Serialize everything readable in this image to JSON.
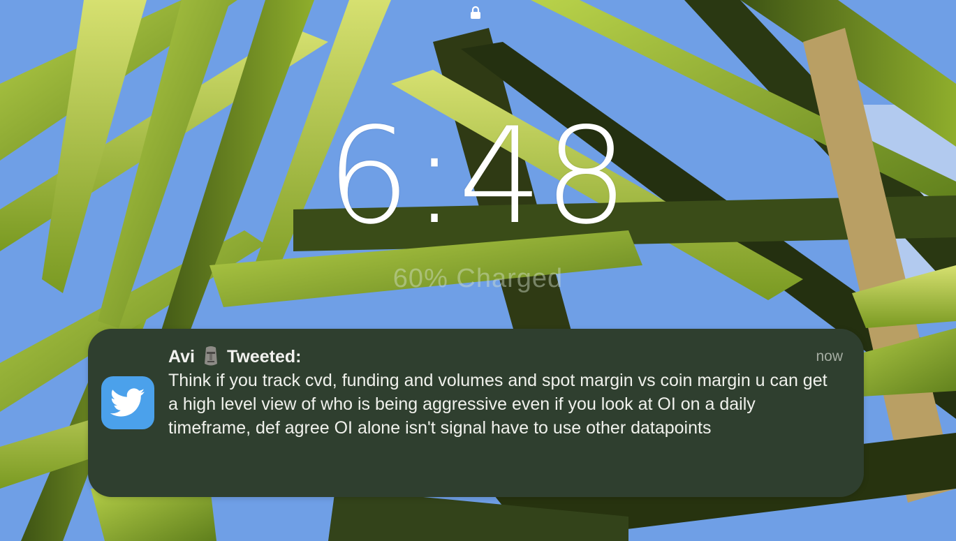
{
  "lock_screen": {
    "time": "6:48",
    "charge_status": "60% Charged"
  },
  "notification": {
    "app_icon": "twitter-bird-icon",
    "sender": "Avi",
    "emoji": "moai-emoji",
    "action": "Tweeted:",
    "timestamp": "now",
    "message": "Think if you track cvd, funding and volumes and spot margin vs coin margin u can get a high level view of who is being aggressive even if you look at OI on a daily timeframe, def agree OI alone isn't signal have to use other datapoints"
  },
  "colors": {
    "notification_bg": "#2f3f2f",
    "twitter_blue": "#4ba1eb",
    "sky": "#6f9fe6"
  }
}
